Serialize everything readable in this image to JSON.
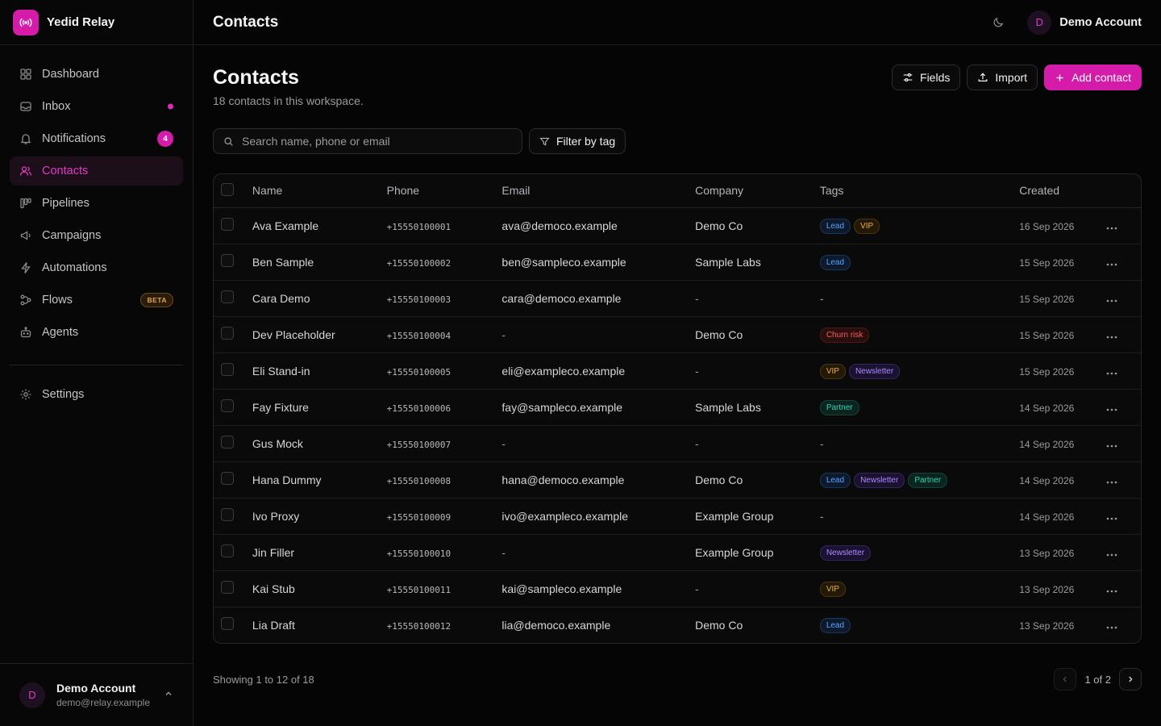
{
  "brand": {
    "name": "Yedid Relay"
  },
  "sidebar": {
    "items": [
      {
        "label": "Dashboard",
        "icon": "grid-icon"
      },
      {
        "label": "Inbox",
        "icon": "inbox-icon"
      },
      {
        "label": "Notifications",
        "icon": "bell-icon",
        "badge": "4"
      },
      {
        "label": "Contacts",
        "icon": "users-icon"
      },
      {
        "label": "Pipelines",
        "icon": "kanban-icon"
      },
      {
        "label": "Campaigns",
        "icon": "megaphone-icon"
      },
      {
        "label": "Automations",
        "icon": "bolt-icon"
      },
      {
        "label": "Flows",
        "icon": "flow-icon",
        "badge": "BETA"
      },
      {
        "label": "Agents",
        "icon": "bot-icon"
      }
    ],
    "settings": {
      "label": "Settings"
    },
    "active": "Contacts"
  },
  "account": {
    "initial": "D",
    "name": "Demo Account",
    "email": "demo@relay.example"
  },
  "topbar": {
    "title": "Contacts",
    "account_name": "Demo Account",
    "account_initial": "D"
  },
  "page": {
    "title": "Contacts",
    "subtitle": "18 contacts in this workspace.",
    "actions": {
      "fields": "Fields",
      "import": "Import",
      "add": "Add contact"
    },
    "search_placeholder": "Search name, phone or email",
    "filter_label": "Filter by tag"
  },
  "table": {
    "headers": {
      "name": "Name",
      "phone": "Phone",
      "email": "Email",
      "company": "Company",
      "tags": "Tags",
      "created": "Created"
    },
    "rows": [
      {
        "name": "Ava Example",
        "phone": "+15550100001",
        "email": "ava@democo.example",
        "company": "Demo Co",
        "tags": [
          "Lead",
          "VIP"
        ],
        "created": "16 Sep 2026"
      },
      {
        "name": "Ben Sample",
        "phone": "+15550100002",
        "email": "ben@sampleco.example",
        "company": "Sample Labs",
        "tags": [
          "Lead"
        ],
        "created": "15 Sep 2026"
      },
      {
        "name": "Cara Demo",
        "phone": "+15550100003",
        "email": "cara@democo.example",
        "company": "-",
        "tags": [],
        "created": "15 Sep 2026"
      },
      {
        "name": "Dev Placeholder",
        "phone": "+15550100004",
        "email": "-",
        "company": "Demo Co",
        "tags": [
          "Churn risk"
        ],
        "created": "15 Sep 2026"
      },
      {
        "name": "Eli Stand-in",
        "phone": "+15550100005",
        "email": "eli@exampleco.example",
        "company": "-",
        "tags": [
          "VIP",
          "Newsletter"
        ],
        "created": "15 Sep 2026"
      },
      {
        "name": "Fay Fixture",
        "phone": "+15550100006",
        "email": "fay@sampleco.example",
        "company": "Sample Labs",
        "tags": [
          "Partner"
        ],
        "created": "14 Sep 2026"
      },
      {
        "name": "Gus Mock",
        "phone": "+15550100007",
        "email": "-",
        "company": "-",
        "tags": [],
        "created": "14 Sep 2026"
      },
      {
        "name": "Hana Dummy",
        "phone": "+15550100008",
        "email": "hana@democo.example",
        "company": "Demo Co",
        "tags": [
          "Lead",
          "Newsletter",
          "Partner"
        ],
        "created": "14 Sep 2026"
      },
      {
        "name": "Ivo Proxy",
        "phone": "+15550100009",
        "email": "ivo@exampleco.example",
        "company": "Example Group",
        "tags": [],
        "created": "14 Sep 2026"
      },
      {
        "name": "Jin Filler",
        "phone": "+15550100010",
        "email": "-",
        "company": "Example Group",
        "tags": [
          "Newsletter"
        ],
        "created": "13 Sep 2026"
      },
      {
        "name": "Kai Stub",
        "phone": "+15550100011",
        "email": "kai@sampleco.example",
        "company": "-",
        "tags": [
          "VIP"
        ],
        "created": "13 Sep 2026"
      },
      {
        "name": "Lia Draft",
        "phone": "+15550100012",
        "email": "lia@democo.example",
        "company": "Demo Co",
        "tags": [
          "Lead"
        ],
        "created": "13 Sep 2026"
      }
    ],
    "empty_tags": "-"
  },
  "footer": {
    "showing": "Showing 1 to 12 of 18",
    "page": "1 of 2"
  },
  "colors": {
    "accent": "#d41ba9",
    "background": "#050505"
  }
}
